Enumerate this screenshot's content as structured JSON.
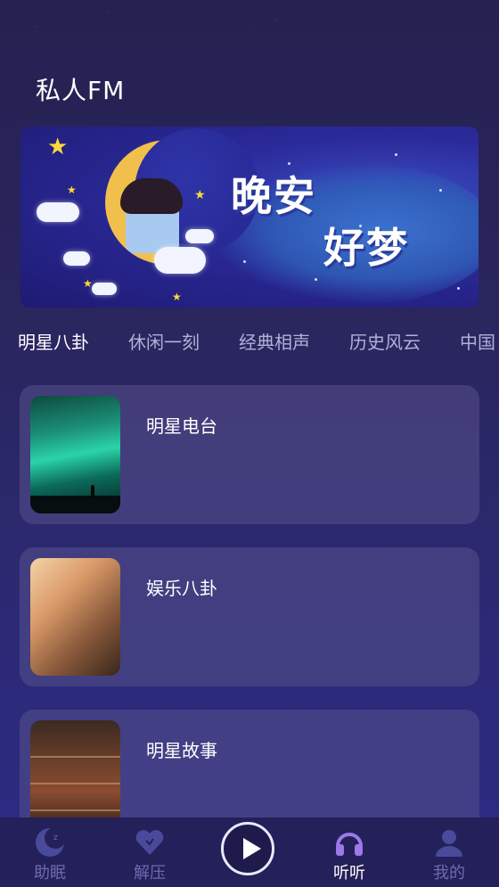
{
  "header": {
    "title": "私人FM"
  },
  "banner": {
    "line1": "晚安",
    "line2": "好梦"
  },
  "tabs": [
    {
      "label": "明星八卦",
      "active": true
    },
    {
      "label": "休闲一刻",
      "active": false
    },
    {
      "label": "经典相声",
      "active": false
    },
    {
      "label": "历史风云",
      "active": false
    },
    {
      "label": "中国",
      "active": false
    }
  ],
  "cards": [
    {
      "label": "明星电台",
      "thumb": "aurora-image"
    },
    {
      "label": "娱乐八卦",
      "thumb": "people-image"
    },
    {
      "label": "明星故事",
      "thumb": "library-image"
    }
  ],
  "tabbar": {
    "items": [
      {
        "label": "助眠",
        "icon": "moon-icon",
        "active": false
      },
      {
        "label": "解压",
        "icon": "heart-icon",
        "active": false
      },
      {
        "label": "听听",
        "icon": "headphones-icon",
        "active": true
      },
      {
        "label": "我的",
        "icon": "user-icon",
        "active": false
      }
    ],
    "play_icon": "play-icon"
  },
  "colors": {
    "background": "#2a2660",
    "card": "#504c8c",
    "tab_inactive": "#b2b1d6",
    "tabbar": "#24205a",
    "tabbar_inactive": "#6c6bb0",
    "active_icon": "#9b79e6"
  }
}
